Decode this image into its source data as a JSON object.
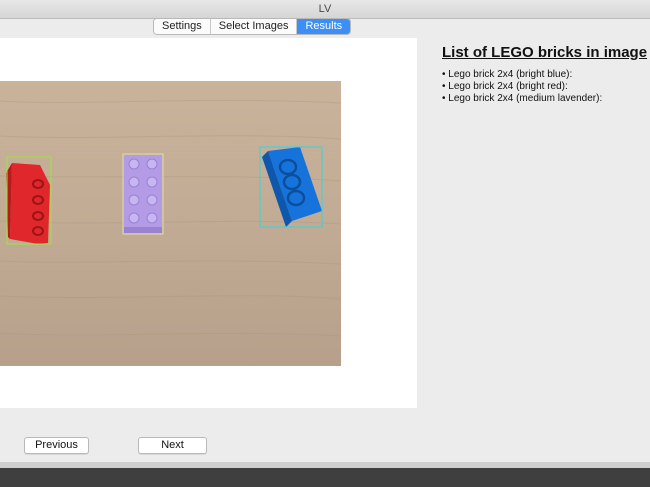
{
  "window": {
    "title": "LV"
  },
  "tabs": [
    {
      "label": "Settings",
      "active": false
    },
    {
      "label": "Select Images",
      "active": false
    },
    {
      "label": "Results",
      "active": true
    }
  ],
  "results": {
    "title": "List of LEGO bricks in image",
    "items": [
      "Lego brick 2x4 (bright blue):",
      "Lego brick 2x4 (bright red):",
      "Lego brick 2x4 (medium lavender):"
    ]
  },
  "buttons": {
    "previous": "Previous",
    "next": "Next"
  },
  "colors": {
    "accent": "#3b8ff6",
    "brick_red": "#e0272b",
    "brick_blue": "#1773dc",
    "brick_lavender": "#b39be6",
    "box_red": "#9be63c",
    "box_blue": "#30d6e0",
    "box_lavender": "#d8e0a8"
  }
}
